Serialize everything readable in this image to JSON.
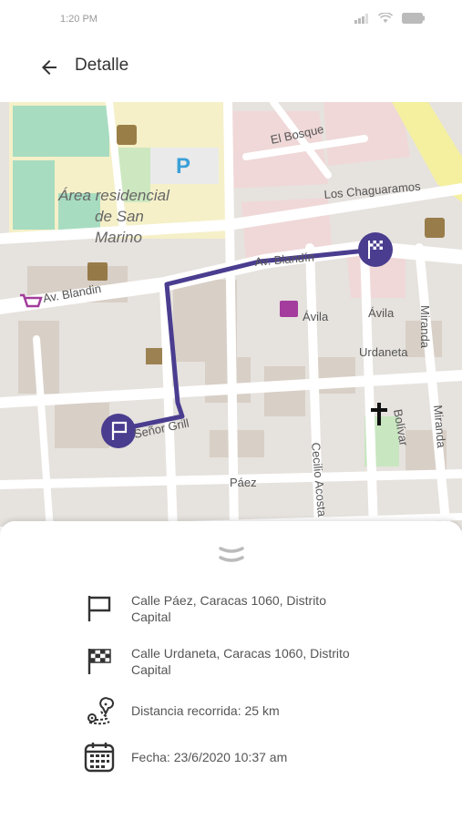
{
  "status_bar": {
    "time": "1:20 PM"
  },
  "header": {
    "title": "Detalle",
    "back_icon": "arrow-left-icon"
  },
  "map": {
    "labels": {
      "area_line1": "Área residencial",
      "area_line2": "de San",
      "area_line3": "Marino",
      "el_bosque": "El Bosque",
      "los_chaguaramos": "Los Chaguaramos",
      "av_blandin_left": "Av. Blandin",
      "av_blandin_right": "Av. Blandín",
      "avila_1": "Ávila",
      "avila_2": "Ávila",
      "urdaneta": "Urdaneta",
      "miranda_1": "Miranda",
      "miranda_2": "Miranda",
      "bolivar": "Bolívar",
      "senor_grill": "Señor Grill",
      "cecilio_acosta": "Cecilio Acosta",
      "paez": "Páez"
    },
    "route_color": "#4a3d8f",
    "start_marker_icon": "flag-icon",
    "end_marker_icon": "checkered-flag-icon"
  },
  "details": {
    "origin": {
      "icon": "flag-icon",
      "text": "Calle Páez, Caracas 1060, Distrito Capital"
    },
    "destination": {
      "icon": "checkered-flag-icon",
      "text": "Calle Urdaneta, Caracas 1060, Distrito Capital"
    },
    "distance": {
      "icon": "route-icon",
      "text": "Distancia recorrida: 25 km"
    },
    "date": {
      "icon": "calendar-icon",
      "text": "Fecha: 23/6/2020 10:37 am"
    }
  }
}
